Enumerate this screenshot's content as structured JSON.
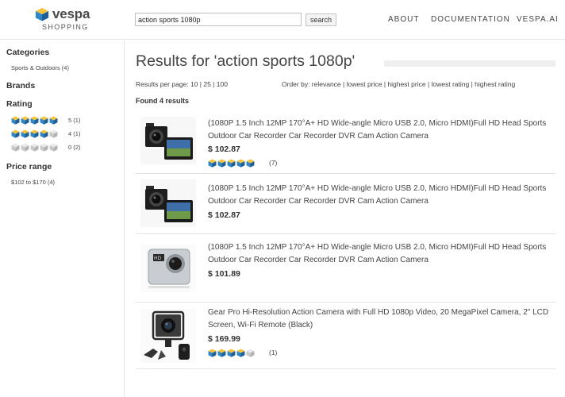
{
  "header": {
    "brand": "vespa",
    "brand_sub": "SHOPPING",
    "search_value": "action sports 1080p",
    "search_button": "search",
    "nav": [
      "ABOUT",
      "DOCUMENTATION",
      "VESPA.AI"
    ]
  },
  "sidebar": {
    "categories_heading": "Categories",
    "categories": [
      "Sports & Outdoors (4)"
    ],
    "brands_heading": "Brands",
    "rating_heading": "Rating",
    "ratings": [
      {
        "stars": 5,
        "label": "5 (1)"
      },
      {
        "stars": 4,
        "label": "4 (1)"
      },
      {
        "stars": 0,
        "label": "0 (2)"
      }
    ],
    "price_heading": "Price range",
    "price_ranges": [
      "$102 to $170 (4)"
    ]
  },
  "main": {
    "title": "Results for 'action sports 1080p'",
    "per_page": "Results per page: 10 | 25 | 100",
    "order_by": "Order by: relevance | lowest price | highest price | lowest rating | highest rating",
    "found": "Found 4 results",
    "results": [
      {
        "title": "(1080P 1.5 Inch 12MP 170°A+ HD Wide-angle Micro USB 2.0,  Micro HDMI)Full HD Head Sports Outdoor Car Recorder Car Recorder DVR Cam Action Camera",
        "price": "$ 102.87",
        "rating": 5,
        "reviews": "(7)",
        "image": "camera-with-screen-icon"
      },
      {
        "title": "(1080P 1.5 Inch 12MP 170°A+ HD Wide-angle Micro USB 2.0,  Micro HDMI)Full HD Head Sports Outdoor Car Recorder Car Recorder DVR Cam Action Camera",
        "price": "$ 102.87",
        "rating": 0,
        "reviews": "",
        "image": "camera-with-screen-icon"
      },
      {
        "title": "(1080P 1.5 Inch 12MP 170°A+ HD Wide-angle Micro USB 2.0,  Micro HDMI)Full HD Head Sports Outdoor Car Recorder Car Recorder DVR Cam Action Camera",
        "price": "$ 101.89",
        "rating": 0,
        "reviews": "",
        "image": "silver-action-camera-icon"
      },
      {
        "title": "Gear Pro Hi-Resolution Action Camera with Full HD 1080p Video, 20 MegaPixel Camera, 2\" LCD Screen, Wi-Fi Remote (Black)",
        "price": "$ 169.99",
        "rating": 4,
        "reviews": "(1)",
        "image": "action-camera-kit-icon"
      }
    ]
  },
  "colors": {
    "cube_top": "#f6c43a",
    "cube_left": "#2f86c8",
    "cube_right": "#1f5f97",
    "cube_off_top": "#e9e9e9",
    "cube_off_left": "#c9c9c9",
    "cube_off_right": "#b3b3b3"
  }
}
